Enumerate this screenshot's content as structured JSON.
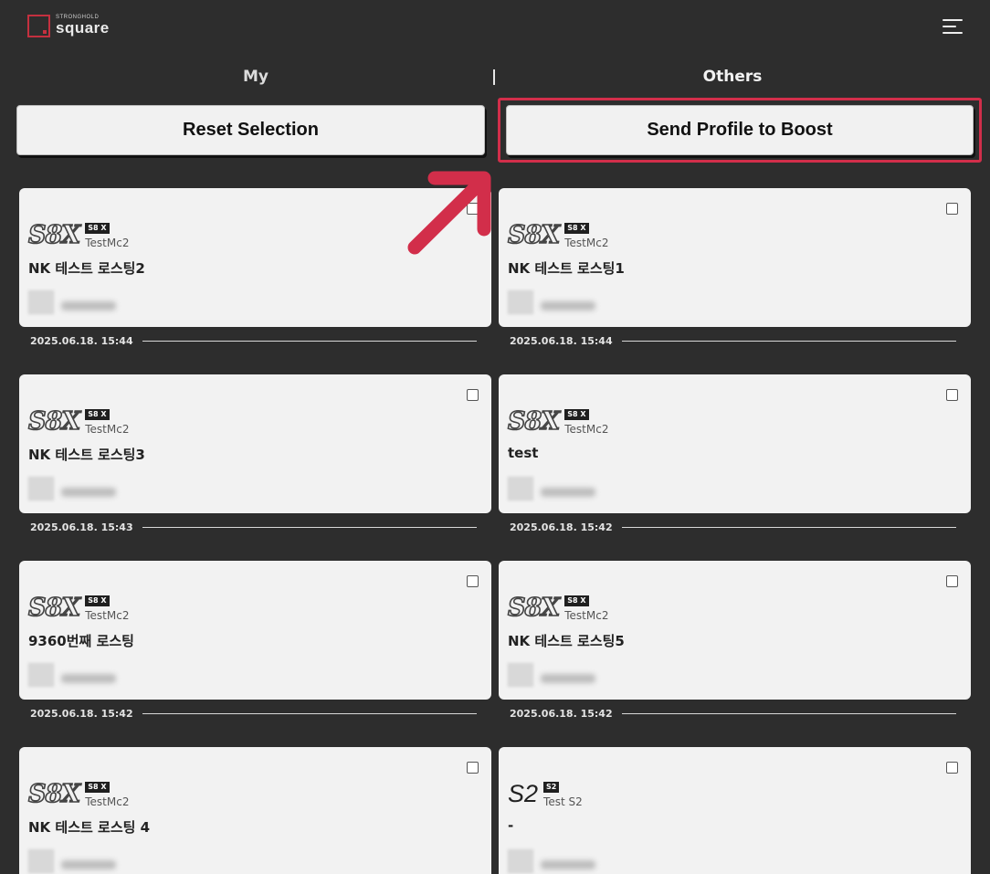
{
  "header": {
    "logo_small": "STRONGHOLD",
    "logo_big": "square",
    "menu_icon": "hamburger-menu-icon"
  },
  "tabs": [
    {
      "label": "My",
      "active": false
    },
    {
      "label": "Others",
      "active": true
    }
  ],
  "actions": {
    "reset_label": "Reset Selection",
    "boost_label": "Send Profile to Boost"
  },
  "accent_color": "#d22e4a",
  "cards": [
    {
      "logo": "S8X",
      "badge": "S8 X",
      "user": "TestMc2",
      "title": "NK 테스트 로스팅2",
      "date": "2025.06.18. 15:44"
    },
    {
      "logo": "S8X",
      "badge": "S8 X",
      "user": "TestMc2",
      "title": "NK 테스트 로스팅1",
      "date": "2025.06.18. 15:44"
    },
    {
      "logo": "S8X",
      "badge": "S8 X",
      "user": "TestMc2",
      "title": "NK 테스트 로스팅3",
      "date": "2025.06.18. 15:43"
    },
    {
      "logo": "S8X",
      "badge": "S8 X",
      "user": "TestMc2",
      "title": "test",
      "date": "2025.06.18. 15:42"
    },
    {
      "logo": "S8X",
      "badge": "S8 X",
      "user": "TestMc2",
      "title": "9360번째 로스팅",
      "date": "2025.06.18. 15:42"
    },
    {
      "logo": "S8X",
      "badge": "S8 X",
      "user": "TestMc2",
      "title": "NK 테스트 로스팅5",
      "date": "2025.06.18. 15:42"
    },
    {
      "logo": "S8X",
      "badge": "S8 X",
      "user": "TestMc2",
      "title": "NK 테스트 로스팅 4",
      "date": ""
    },
    {
      "logo": "S2",
      "badge": "S2",
      "user": "Test S2",
      "title": "-",
      "date": ""
    }
  ]
}
